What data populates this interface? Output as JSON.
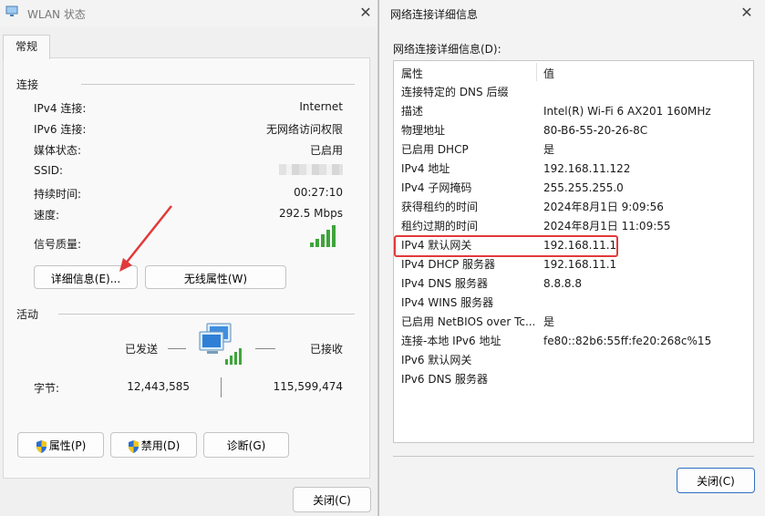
{
  "left_window": {
    "title": "WLAN 状态",
    "tab_label": "常规",
    "connection_group": {
      "title": "连接",
      "rows": [
        {
          "label": "IPv4 连接:",
          "value": "Internet"
        },
        {
          "label": "IPv6 连接:",
          "value": "无网络访问权限"
        },
        {
          "label": "媒体状态:",
          "value": "已启用"
        },
        {
          "label": "SSID:",
          "value": ""
        },
        {
          "label": "持续时间:",
          "value": "00:27:10"
        },
        {
          "label": "速度:",
          "value": "292.5 Mbps"
        }
      ],
      "signal_label": "信号质量:",
      "signal_bars": 5,
      "details_button": "详细信息(E)...",
      "wireless_props_button": "无线属性(W)"
    },
    "activity_group": {
      "title": "活动",
      "sent_label": "已发送",
      "received_label": "已接收",
      "bytes_label": "字节:",
      "bytes_sent": "12,443,585",
      "bytes_received": "115,599,474"
    },
    "buttons": {
      "properties": "属性(P)",
      "disable": "禁用(D)",
      "diagnose": "诊断(G)",
      "close": "关闭(C)"
    }
  },
  "right_window": {
    "title": "网络连接详细信息",
    "list_caption": "网络连接详细信息(D):",
    "headers": {
      "property": "属性",
      "value": "值"
    },
    "rows": [
      {
        "property": "连接特定的 DNS 后缀",
        "value": ""
      },
      {
        "property": "描述",
        "value": "Intel(R) Wi-Fi 6 AX201 160MHz"
      },
      {
        "property": "物理地址",
        "value": "80-B6-55-20-26-8C"
      },
      {
        "property": "已启用 DHCP",
        "value": "是"
      },
      {
        "property": "IPv4 地址",
        "value": "192.168.11.122"
      },
      {
        "property": "IPv4 子网掩码",
        "value": "255.255.255.0"
      },
      {
        "property": "获得租约的时间",
        "value": "2024年8月1日 9:09:56"
      },
      {
        "property": "租约过期的时间",
        "value": "2024年8月1日 11:09:55"
      },
      {
        "property": "IPv4 默认网关",
        "value": "192.168.11.1"
      },
      {
        "property": "IPv4 DHCP 服务器",
        "value": "192.168.11.1"
      },
      {
        "property": "IPv4 DNS 服务器",
        "value": "8.8.8.8"
      },
      {
        "property": "IPv4 WINS 服务器",
        "value": ""
      },
      {
        "property": "已启用 NetBIOS over Tc...",
        "value": "是"
      },
      {
        "property": "连接-本地 IPv6 地址",
        "value": "fe80::82b6:55ff:fe20:268c%15"
      },
      {
        "property": "IPv6 默认网关",
        "value": ""
      },
      {
        "property": "IPv6 DNS 服务器",
        "value": ""
      }
    ],
    "highlighted_row": "IPv4 默认网关",
    "close_button": "关闭(C)"
  },
  "colors": {
    "annotation_red": "#e23a3a",
    "signal_green": "#3fa43b",
    "window_bg": "#f0f0f0"
  }
}
